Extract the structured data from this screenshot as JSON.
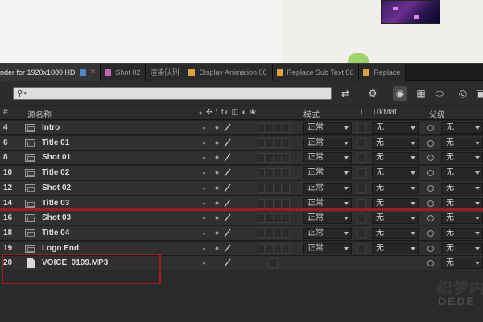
{
  "tabs": [
    {
      "label": "nder for 1920x1080 HD",
      "color": "#4a86c8",
      "active": true,
      "closable": true
    },
    {
      "label": "Shot 02",
      "color": "#c466b8",
      "active": false
    },
    {
      "label": "渲染队列",
      "color": "",
      "active": false
    },
    {
      "label": "Display Animation 06",
      "color": "#d9a33a",
      "active": false
    },
    {
      "label": "Replace Sub Text 06",
      "color": "#d9a33a",
      "active": false
    },
    {
      "label": "Replace",
      "color": "#d9a33a",
      "active": false
    }
  ],
  "toolbar": {
    "search_icon": "search-icon",
    "search_value": "",
    "tools": [
      "composition-flowchart-icon",
      "render-preview-icon",
      "comp-mini-flowchart-icon",
      "draft-3d-icon",
      "frame-blending-icon",
      "motion-blur-icon",
      "graph-editor-icon",
      "brainstorm-icon"
    ]
  },
  "columns": {
    "hash": "#",
    "source_name": "源名称",
    "switches": "⁎ ✣ \\ fx ◫ ◐ ❀",
    "mode": "模式",
    "t": "T",
    "trkmat": "TrkMat",
    "parent": "父级"
  },
  "layers": [
    {
      "num": "4",
      "name": "Intro",
      "type": "comp",
      "mode": "正常",
      "trkmat": "无",
      "parent": "无"
    },
    {
      "num": "6",
      "name": "Title 01",
      "type": "comp",
      "mode": "正常",
      "trkmat": "无",
      "parent": "无"
    },
    {
      "num": "8",
      "name": "Shot 01",
      "type": "comp",
      "mode": "正常",
      "trkmat": "无",
      "parent": "无"
    },
    {
      "num": "10",
      "name": "Title 02",
      "type": "comp",
      "mode": "正常",
      "trkmat": "无",
      "parent": "无"
    },
    {
      "num": "12",
      "name": "Shot 02",
      "type": "comp",
      "mode": "正常",
      "trkmat": "无",
      "parent": "无"
    },
    {
      "num": "14",
      "name": "Title 03",
      "type": "comp",
      "mode": "正常",
      "trkmat": "无",
      "parent": "无"
    },
    {
      "num": "16",
      "name": "Shot 03",
      "type": "comp",
      "mode": "正常",
      "trkmat": "无",
      "parent": "无"
    },
    {
      "num": "18",
      "name": "Title 04",
      "type": "comp",
      "mode": "正常",
      "trkmat": "无",
      "parent": "无"
    },
    {
      "num": "19",
      "name": "Logo End",
      "type": "comp",
      "mode": "正常",
      "trkmat": "无",
      "parent": "无"
    },
    {
      "num": "20",
      "name": "VOICE_0109.MP3",
      "type": "audio",
      "mode": "",
      "trkmat": "",
      "parent": "无"
    }
  ],
  "watermark": {
    "line1": "织梦内",
    "line2": "DEDE"
  },
  "colors": {
    "panel": "#303030",
    "highlight": "#a11c1c",
    "accent_blue": "#4a86c8"
  }
}
